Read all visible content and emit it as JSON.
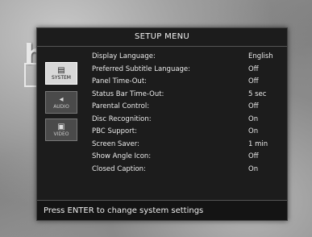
{
  "background": {
    "logo_letter": "h"
  },
  "menu": {
    "title": "SETUP MENU",
    "tabs": [
      {
        "label": "SYSTEM",
        "icon": "system-icon"
      },
      {
        "label": "AUDIO",
        "icon": "speaker-icon"
      },
      {
        "label": "VIDEO",
        "icon": "video-icon"
      }
    ],
    "settings": [
      {
        "label": "Display Language:",
        "value": "English"
      },
      {
        "label": "Preferred Subtitle Language:",
        "value": "Off"
      },
      {
        "label": "Panel Time-Out:",
        "value": "Off"
      },
      {
        "label": "Status Bar Time-Out:",
        "value": "5 sec"
      },
      {
        "label": "Parental Control:",
        "value": "Off"
      },
      {
        "label": "Disc Recognition:",
        "value": "On"
      },
      {
        "label": "PBC Support:",
        "value": "On"
      },
      {
        "label": "Screen Saver:",
        "value": "1 min"
      },
      {
        "label": "Show Angle Icon:",
        "value": "Off"
      },
      {
        "label": "Closed Caption:",
        "value": "On"
      }
    ],
    "footer": "Press ENTER to change system settings"
  }
}
